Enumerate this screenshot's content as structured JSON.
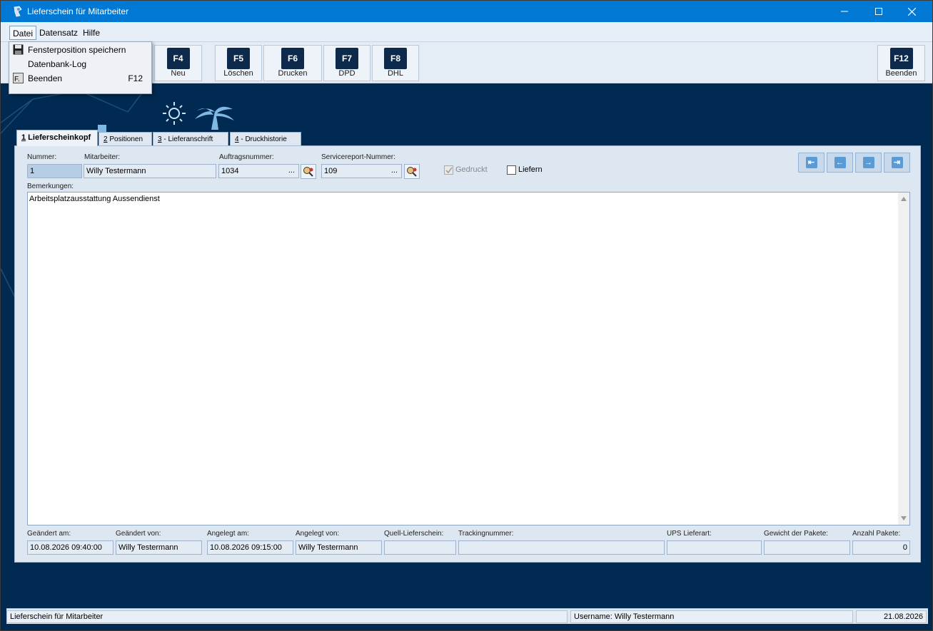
{
  "window": {
    "title": "Lieferschein für Mitarbeiter",
    "controls": {
      "minimize": "—",
      "maximize": "☐",
      "close": "✕"
    }
  },
  "menubar": {
    "items": [
      "Datei",
      "Datensatz",
      "Hilfe"
    ]
  },
  "file_menu": {
    "items": [
      {
        "label": "Fensterposition speichern",
        "shortcut": "",
        "icon": "save-icon"
      },
      {
        "label": "Datenbank-Log",
        "shortcut": "",
        "icon": ""
      },
      {
        "label": "Beenden",
        "shortcut": "F12",
        "icon": "exit-icon"
      }
    ]
  },
  "toolbar": {
    "buttons": [
      {
        "key": "F4",
        "label": "Neu"
      },
      {
        "key": "F5",
        "label": "Löschen"
      },
      {
        "key": "F6",
        "label": "Drucken"
      },
      {
        "key": "F7",
        "label": "DPD"
      },
      {
        "key": "F8",
        "label": "DHL"
      },
      {
        "key": "F12",
        "label": "Beenden"
      }
    ]
  },
  "tabs": [
    {
      "acc": "1",
      "label": " Lieferscheinkopf"
    },
    {
      "acc": "2",
      "label": " Positionen"
    },
    {
      "acc": "3",
      "label": " - Lieferanschrift"
    },
    {
      "acc": "4",
      "label": " - Druckhistorie"
    }
  ],
  "form": {
    "nummer": {
      "label": "Nummer:",
      "value": "1"
    },
    "mitarbeiter": {
      "label": "Mitarbeiter:",
      "value": "Willy Testermann"
    },
    "auftragsnummer": {
      "label": "Auftragsnummer:",
      "value": "1034",
      "ellipsis": "..."
    },
    "servicereport": {
      "label": "Servicereport-Nummer:",
      "value": "109",
      "ellipsis": "..."
    },
    "gedruckt": {
      "label": "Gedruckt",
      "checked": true,
      "disabled": true
    },
    "liefern": {
      "label": "Liefern",
      "checked": false
    },
    "bemerkungen": {
      "label": "Bemerkungen:",
      "value": "Arbeitsplatzausstattung Aussendienst"
    }
  },
  "nav_buttons": [
    "first",
    "previous",
    "next",
    "last"
  ],
  "footer_fields": {
    "geaendert_am": {
      "label": "Geändert am:",
      "value": "10.08.2026 09:40:00"
    },
    "geaendert_von": {
      "label": "Geändert von:",
      "value": "Willy Testermann"
    },
    "angelegt_am": {
      "label": "Angelegt am:",
      "value": "10.08.2026 09:15:00"
    },
    "angelegt_von": {
      "label": "Angelegt von:",
      "value": "Willy Testermann"
    },
    "quell_lieferschein": {
      "label": "Quell-Lieferschein:",
      "value": ""
    },
    "trackingnummer": {
      "label": "Trackingnummer:",
      "value": ""
    },
    "ups_lieferart": {
      "label": "UPS Lieferart:",
      "value": ""
    },
    "gewicht": {
      "label": "Gewicht der Pakete:",
      "value": ""
    },
    "anzahl": {
      "label": "Anzahl Pakete:",
      "value": "0"
    }
  },
  "statusbar": {
    "left": "Lieferschein für Mitarbeiter",
    "user": "Username: Willy Testermann",
    "date": "21.08.2026"
  },
  "colors": {
    "titlebar": "#0078d4",
    "background": "#002a52",
    "key_badge": "#0d2a4d",
    "nav_accent": "#5b9bd5"
  }
}
